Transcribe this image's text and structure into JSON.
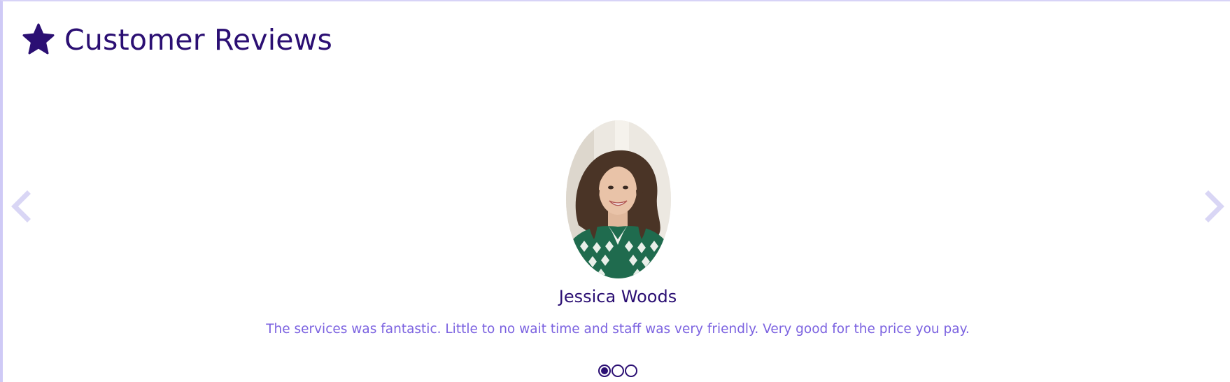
{
  "header": {
    "title": "Customer Reviews",
    "icon": "star-icon"
  },
  "carousel": {
    "prev_icon": "chevron-left-icon",
    "next_icon": "chevron-right-icon",
    "active_index": 0,
    "slide_count": 3,
    "slide": {
      "name": "Jessica Woods",
      "review": "The services was fantastic. Little to no wait time and staff was very friendly. Very good for the price you pay."
    }
  },
  "colors": {
    "primary": "#2b0f73",
    "review_text": "#7b62e0",
    "arrow": "#d9d6f5",
    "frame_border": "#cfcaf6"
  }
}
